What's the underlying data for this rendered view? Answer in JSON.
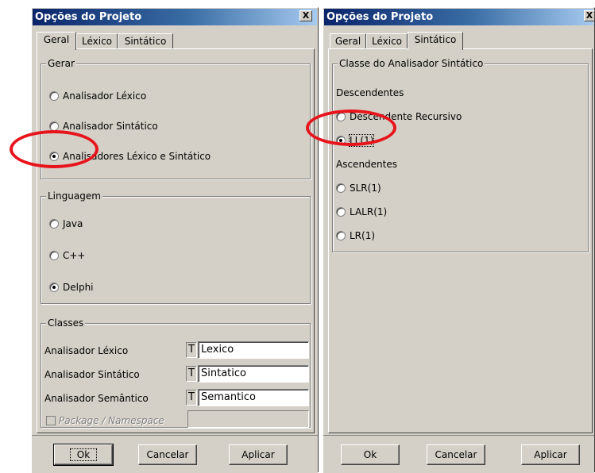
{
  "left_dialog": {
    "title": "Opções do Projeto",
    "close_label": "X",
    "tabs": [
      {
        "label": "Geral"
      },
      {
        "label": "Léxico"
      },
      {
        "label": "Sintático"
      }
    ],
    "groups": {
      "gerar": {
        "legend": "Gerar",
        "options": [
          {
            "label": "Analisador Léxico",
            "checked": false
          },
          {
            "label": "Analisador Sintático",
            "checked": false
          },
          {
            "label": "Analisadores Léxico e Sintático",
            "checked": true
          }
        ]
      },
      "linguagem": {
        "legend": "Linguagem",
        "options": [
          {
            "label": "Java",
            "checked": false
          },
          {
            "label": "C++",
            "checked": false
          },
          {
            "label": "Delphi",
            "checked": true
          }
        ]
      },
      "classes": {
        "legend": "Classes",
        "rows": [
          {
            "label": "Analisador Léxico",
            "type_tag": "T",
            "value": "Lexico"
          },
          {
            "label": "Analisador Sintático",
            "type_tag": "T",
            "value": "Sintatico"
          },
          {
            "label": "Analisador Semântico",
            "type_tag": "T",
            "value": "Semantico"
          }
        ],
        "package_label": "Package / Namespace",
        "package_value": ""
      }
    },
    "buttons": {
      "ok": "Ok",
      "cancel": "Cancelar",
      "apply": "Aplicar"
    }
  },
  "right_dialog": {
    "title": "Opções do Projeto",
    "close_label": "X",
    "tabs": [
      {
        "label": "Geral"
      },
      {
        "label": "Léxico"
      },
      {
        "label": "Sintático"
      }
    ],
    "group": {
      "legend": "Classe do Analisador Sintático",
      "descendentes_label": "Descendentes",
      "descendentes": [
        {
          "label": "Descendente Recursivo",
          "checked": false
        },
        {
          "label": "LL(1)",
          "checked": true
        }
      ],
      "ascendentes_label": "Ascendentes",
      "ascendentes": [
        {
          "label": "SLR(1)",
          "checked": false
        },
        {
          "label": "LALR(1)",
          "checked": false
        },
        {
          "label": "LR(1)",
          "checked": false
        }
      ]
    },
    "buttons": {
      "ok": "Ok",
      "cancel": "Cancelar",
      "apply": "Aplicar"
    }
  },
  "colors": {
    "window_bg": "#d4d0c8",
    "title_start": "#0a246a",
    "title_end": "#a6caf0",
    "annotation_red": "#e8141c"
  }
}
